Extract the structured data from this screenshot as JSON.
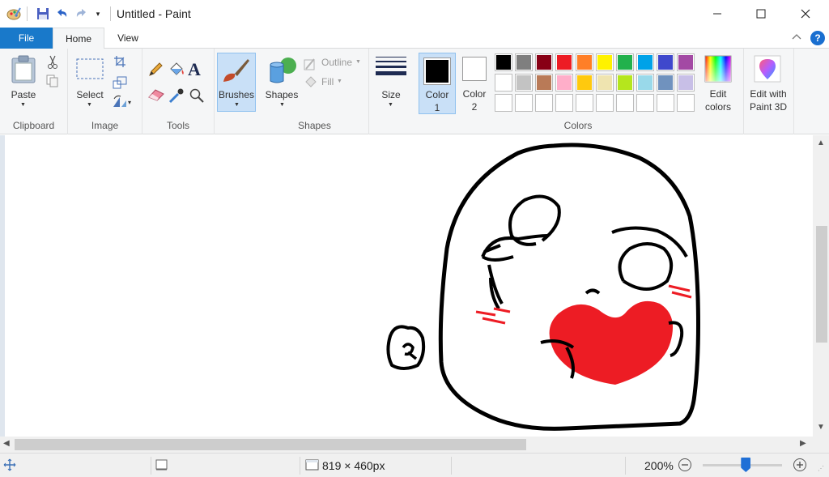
{
  "window": {
    "title": "Untitled - Paint"
  },
  "tabs": {
    "file": "File",
    "home": "Home",
    "view": "View"
  },
  "ribbon": {
    "clipboard": {
      "group_label": "Clipboard",
      "paste_label": "Paste"
    },
    "image": {
      "group_label": "Image",
      "select_label": "Select"
    },
    "tools": {
      "group_label": "Tools",
      "text_glyph": "A"
    },
    "brushes": {
      "label": "Brushes"
    },
    "shapes": {
      "group_label": "Shapes",
      "shapes_label": "Shapes",
      "outline_label": "Outline",
      "fill_label": "Fill"
    },
    "size": {
      "label": "Size"
    },
    "colors": {
      "group_label": "Colors",
      "color1_label": "Color",
      "color1_num": "1",
      "color2_label": "Color",
      "color2_num": "2",
      "color1": "#000000",
      "color2": "#ffffff",
      "edit_colors_line1": "Edit",
      "edit_colors_line2": "colors",
      "paint3d_line1": "Edit with",
      "paint3d_line2": "Paint 3D",
      "palette_row1": [
        "#000000",
        "#7f7f7f",
        "#880015",
        "#ed1c24",
        "#ff7f27",
        "#fff200",
        "#22b14c",
        "#00a2e8",
        "#3f48cc",
        "#a349a4"
      ],
      "palette_row2": [
        "#ffffff",
        "#c3c3c3",
        "#b97a57",
        "#ffaec9",
        "#ffc90e",
        "#efe4b0",
        "#b5e61d",
        "#99d9ea",
        "#7092be",
        "#c8bfe7"
      ]
    }
  },
  "status": {
    "dimensions": "819 × 460px",
    "zoom": "200%",
    "zoom_fraction": 0.55
  },
  "accent": "#1979ca"
}
